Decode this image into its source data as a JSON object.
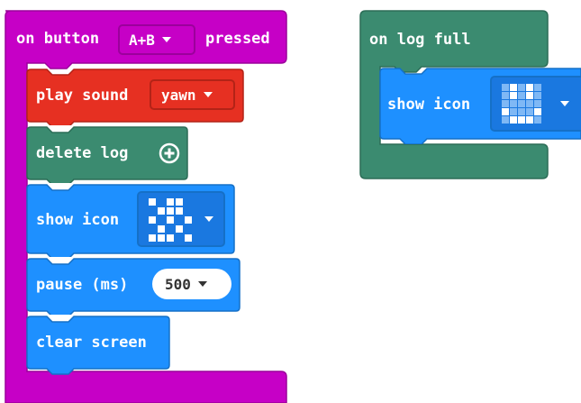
{
  "event_buttons": {
    "prefix": "on button",
    "button_value": "A+B",
    "suffix": "pressed"
  },
  "play_sound": {
    "label": "play sound",
    "sound_value": "yawn"
  },
  "delete_log": {
    "label": "delete log"
  },
  "show_icon_1": {
    "label": "show icon",
    "icon": "checkerboard-pattern-icon"
  },
  "pause": {
    "label": "pause (ms)",
    "value": "500"
  },
  "clear_screen": {
    "label": "clear screen"
  },
  "event_log_full": {
    "label": "on log full"
  },
  "show_icon_2": {
    "label": "show icon",
    "icon": "happy-face-icon"
  },
  "colors": {
    "event_magenta": "#C600C6",
    "event_magenta_dark": "#9C009C",
    "music_red": "#E63022",
    "music_red_dark": "#B32317",
    "log_green": "#3B8B70",
    "log_green_dark": "#2C6D57",
    "basic_blue": "#1E90FF",
    "basic_blue_dark": "#1570C7",
    "dropdown_dark_blue": "#1A78E0"
  }
}
